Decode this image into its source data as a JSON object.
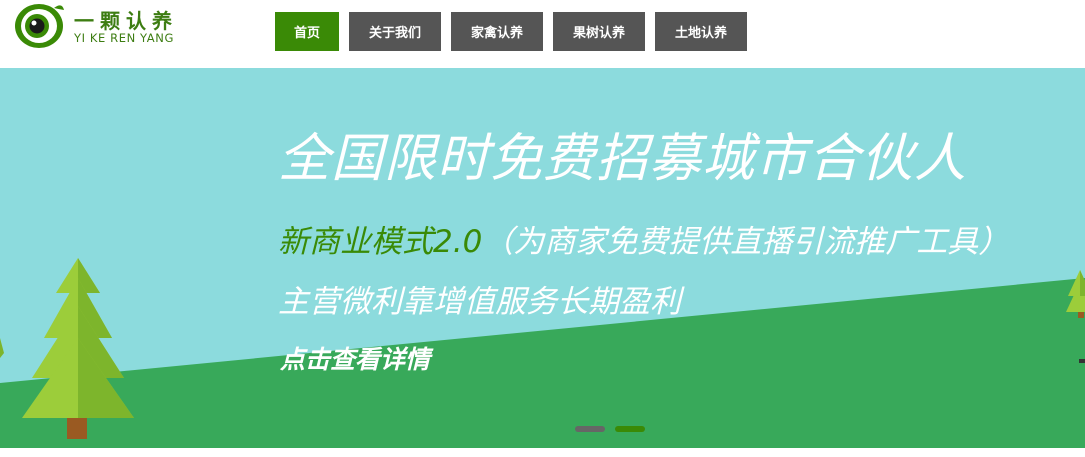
{
  "logo": {
    "cn": "一颗认养",
    "en": "YI KE REN YANG",
    "icon": "eye-logo-icon"
  },
  "nav": {
    "items": [
      {
        "label": "首页",
        "active": true
      },
      {
        "label": "关于我们",
        "active": false
      },
      {
        "label": "家禽认养",
        "active": false
      },
      {
        "label": "果树认养",
        "active": false
      },
      {
        "label": "土地认养",
        "active": false
      }
    ]
  },
  "banner": {
    "headline": "全国限时免费招募城市合伙人",
    "subtitle_green": "新商业模式2.0",
    "subtitle_white": "（为商家免费提供直播引流推广工具）",
    "subtitle2": "主营微利靠增值服务长期盈利",
    "cta": "点击查看详情",
    "slides": [
      {
        "active": false
      },
      {
        "active": true
      }
    ]
  },
  "colors": {
    "brand_green": "#3a8a06",
    "nav_gray": "#555555",
    "sky": "#8cdbdd",
    "grass": "#38a95a",
    "dot_inactive": "#666666",
    "dot_active": "#3a8a06"
  }
}
